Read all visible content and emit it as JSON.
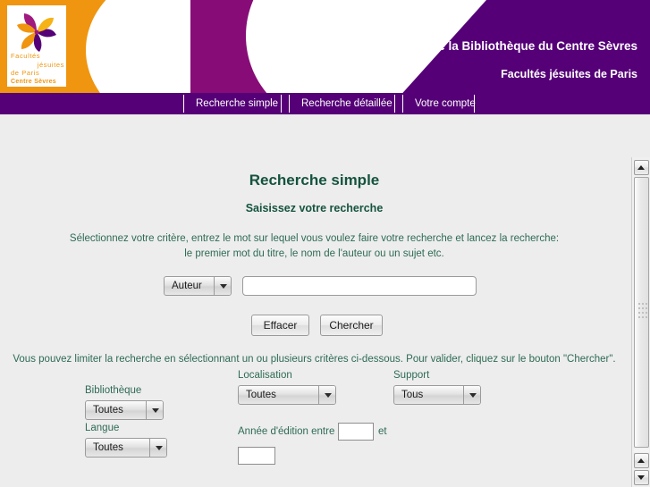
{
  "header": {
    "title_main": "ue de la Bibliothèque du Centre Sèvres",
    "title_sub": "Facultés jésuites de Paris",
    "logo": {
      "line1": "Facultés",
      "line2": "jésuites",
      "line3": "de Paris",
      "line4": "Centre Sèvres"
    },
    "colors": {
      "purple": "#550077",
      "magenta": "#870c77",
      "orange": "#f0950f",
      "heading_green": "#15533f",
      "body_green": "#2e6b54",
      "page_bg": "#ededed"
    }
  },
  "nav": {
    "items": [
      {
        "label": "Recherche simple"
      },
      {
        "label": "Recherche détaillée"
      },
      {
        "label": "Votre compte"
      }
    ]
  },
  "main": {
    "page_title": "Recherche simple",
    "page_subtitle": "Saisissez votre recherche",
    "intro_line_1": "Sélectionnez votre critère, entrez le mot sur lequel vous voulez faire votre recherche et lancez la recherche:",
    "intro_line_2": "le premier mot du titre, le nom de l'auteur ou un sujet etc.",
    "search": {
      "criterion_selected": "Auteur",
      "query_value": "",
      "query_placeholder": ""
    },
    "buttons": {
      "clear": "Effacer",
      "search": "Chercher"
    },
    "limit_note": "Vous pouvez limiter la recherche en sélectionnant un ou plusieurs critères ci-dessous. Pour valider, cliquez sur le bouton \"Chercher\".",
    "filters": {
      "bibliotheque_label": "Bibliothèque",
      "bibliotheque_value": "Toutes",
      "langue_label": "Langue",
      "langue_value": "Toutes",
      "localisation_label": "Localisation",
      "localisation_value": "Toutes",
      "support_label": "Support",
      "support_value": "Tous",
      "annee_label": "Année d'édition entre",
      "annee_separator": "et",
      "annee_from": "",
      "annee_to": ""
    }
  }
}
